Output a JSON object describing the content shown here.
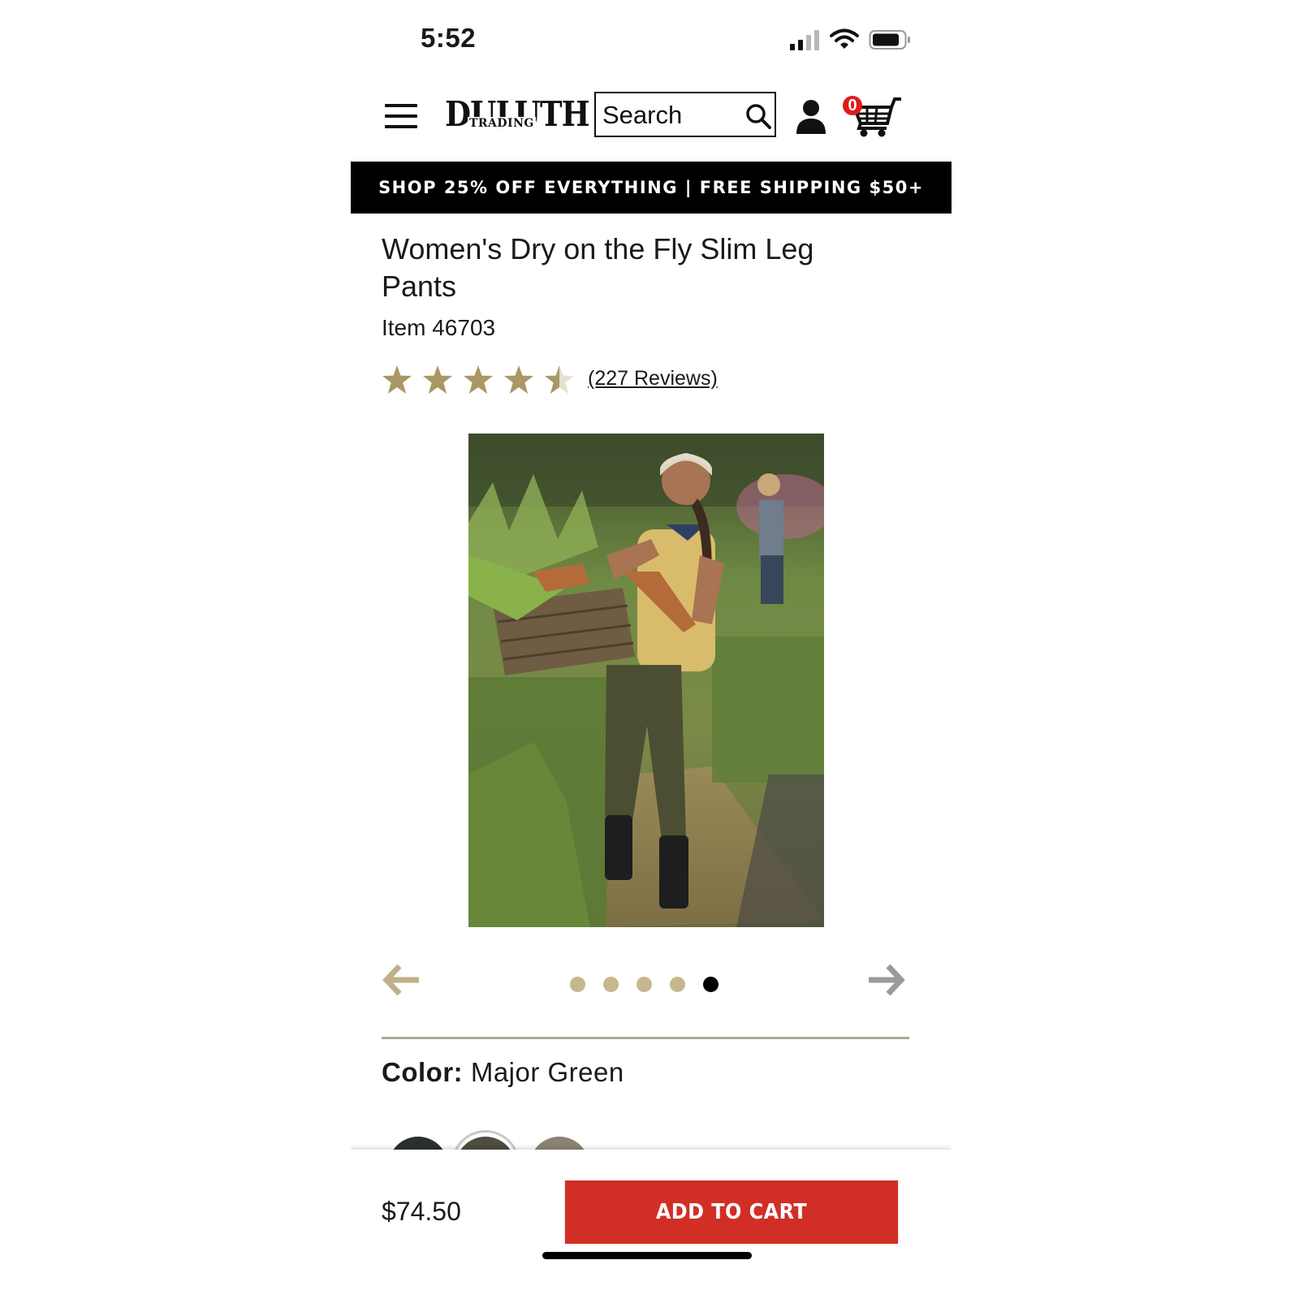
{
  "status_bar": {
    "time": "5:52",
    "icons": [
      "cellular-signal-icon",
      "wifi-icon",
      "battery-icon"
    ]
  },
  "header": {
    "logo": {
      "main": "DULUTH",
      "sub": "TRADING"
    },
    "search_placeholder": "Search",
    "cart_count": "0",
    "icons": [
      "hamburger-menu-icon",
      "search-icon",
      "account-icon",
      "cart-icon"
    ]
  },
  "promo": {
    "text": "SHOP 25% OFF EVERYTHING | FREE SHIPPING $50+"
  },
  "product": {
    "title": "Women's Dry on the Fly Slim Leg Pants",
    "item_number": "Item 46703",
    "rating": 4.5,
    "rating_max": 5,
    "reviews_text": "(227 Reviews)"
  },
  "gallery": {
    "image_count": 5,
    "active_index": 4
  },
  "color": {
    "label": "Color:",
    "value": "Major Green",
    "swatches": [
      {
        "color": "#2c2f2f",
        "selected": false
      },
      {
        "color": "#4e4d3f",
        "selected": true
      },
      {
        "color": "#8b8373",
        "selected": false
      }
    ]
  },
  "cart_bar": {
    "price": "$74.50",
    "button_label": "ADD TO CART"
  },
  "colors": {
    "promo_bg": "#000000",
    "star": "#a99764",
    "dot_inactive": "#c7b78f",
    "dot_active": "#000000",
    "cta": "#d12f26",
    "badge": "#e01b1b"
  }
}
